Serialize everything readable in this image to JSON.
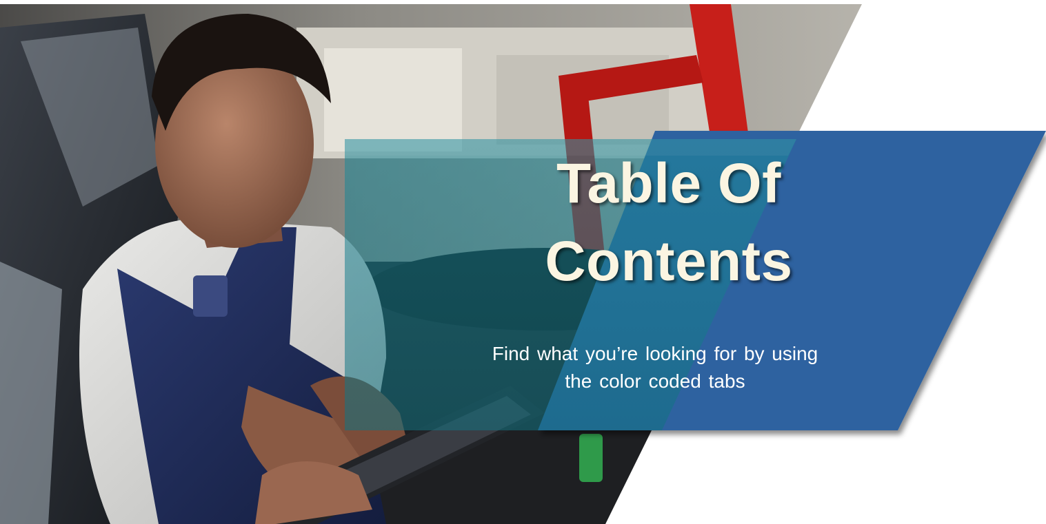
{
  "slide": {
    "title_line_1": "Table Of",
    "title_line_2": "Contents",
    "subtitle_line_1": "Find what you’re looking for by using",
    "subtitle_line_2": "the color coded tabs"
  },
  "photo": {
    "subject": "technician-with-tablet-in-truck-cab-icon"
  },
  "colors": {
    "banner_blue": "#2d62a0",
    "title_text": "#fbf5e2",
    "subtitle_text": "#ffffff",
    "background": "#ffffff"
  }
}
